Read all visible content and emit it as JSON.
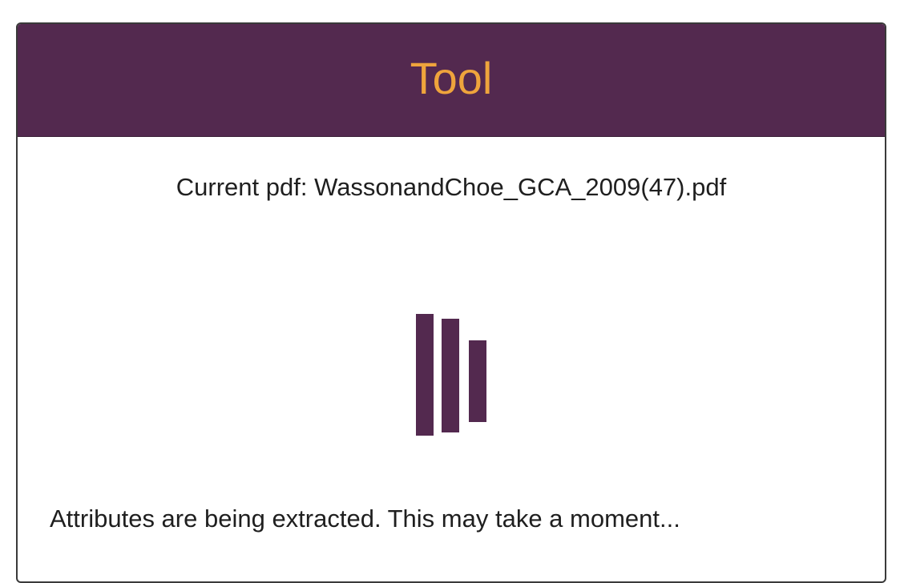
{
  "colors": {
    "header_bg": "#53294f",
    "title_color": "#efa43c",
    "loader_bar": "#53294f"
  },
  "header": {
    "title": "Tool"
  },
  "main": {
    "current_pdf_text": "Current pdf: WassonandChoe_GCA_2009(47).pdf",
    "status_text": "Attributes are being extracted. This may take a moment..."
  }
}
